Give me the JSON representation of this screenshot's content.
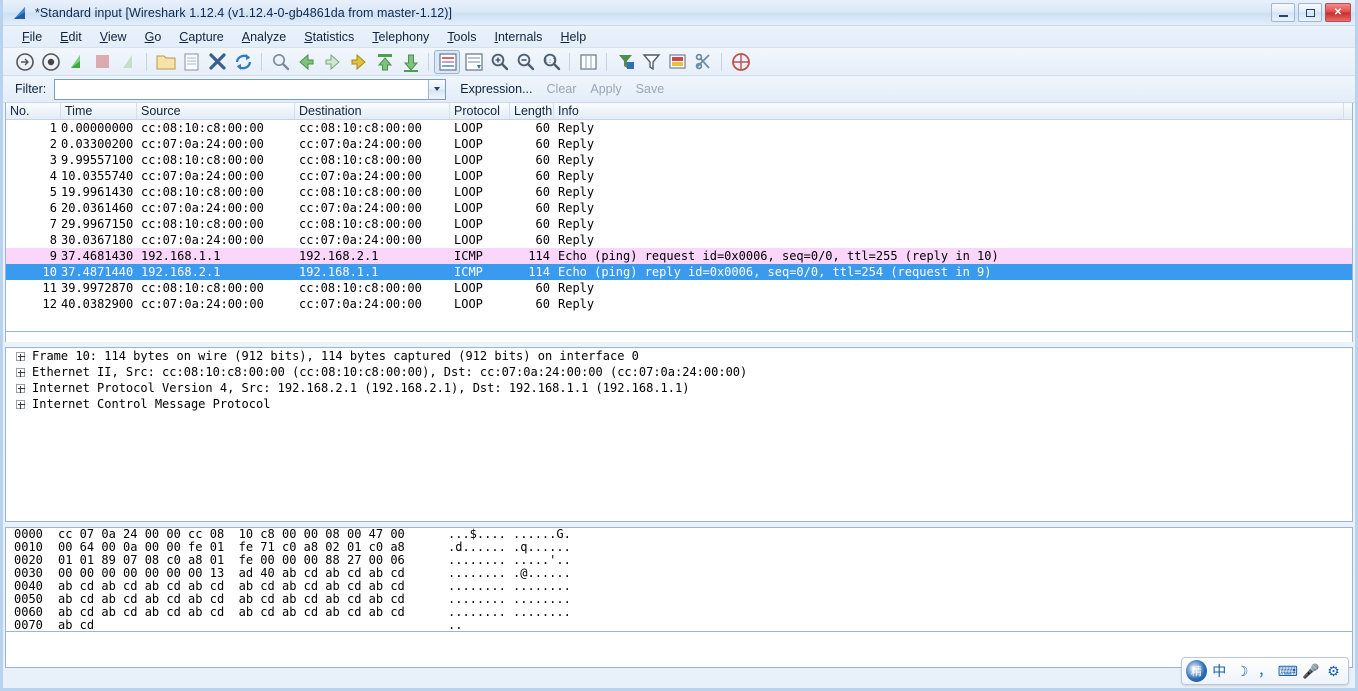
{
  "window": {
    "title": "*Standard input  [Wireshark 1.12.4  (v1.12.4-0-gb4861da from master-1.12)]",
    "icon": "wireshark-fin-icon",
    "minimize_label": "",
    "maximize_label": "",
    "close_label": "✕"
  },
  "menu": {
    "items": [
      {
        "label": "File",
        "accel": "F"
      },
      {
        "label": "Edit",
        "accel": "E"
      },
      {
        "label": "View",
        "accel": "V"
      },
      {
        "label": "Go",
        "accel": "G"
      },
      {
        "label": "Capture",
        "accel": "C"
      },
      {
        "label": "Analyze",
        "accel": "A"
      },
      {
        "label": "Statistics",
        "accel": "S"
      },
      {
        "label": "Telephony",
        "accel": "T"
      },
      {
        "label": "Tools",
        "accel": "T"
      },
      {
        "label": "Internals",
        "accel": "I"
      },
      {
        "label": "Help",
        "accel": "H"
      }
    ]
  },
  "toolbar": {
    "buttons": [
      {
        "name": "interfaces-icon",
        "title": "List the available capture interfaces",
        "enabled": true
      },
      {
        "name": "capture-options-icon",
        "title": "Show the capture options",
        "enabled": true
      },
      {
        "name": "start-capture-icon",
        "title": "Start a new live capture",
        "enabled": true
      },
      {
        "name": "stop-capture-icon",
        "title": "Stop the running live capture",
        "enabled": false
      },
      {
        "name": "restart-capture-icon",
        "title": "Restart the running live capture",
        "enabled": false
      },
      {
        "name": "open-file-icon",
        "title": "Open a capture file",
        "enabled": true
      },
      {
        "name": "save-file-icon",
        "title": "Save this capture file",
        "enabled": true
      },
      {
        "name": "close-file-icon",
        "title": "Close this capture file",
        "enabled": true
      },
      {
        "name": "reload-file-icon",
        "title": "Reload this capture file",
        "enabled": true
      },
      {
        "name": "find-packet-icon",
        "title": "Find a packet",
        "enabled": true
      },
      {
        "name": "go-back-icon",
        "title": "Go back in packet history",
        "enabled": true
      },
      {
        "name": "go-forward-icon",
        "title": "Go forward in packet history",
        "enabled": true
      },
      {
        "name": "go-to-packet-icon",
        "title": "Go to a specific packet",
        "enabled": true
      },
      {
        "name": "go-first-packet-icon",
        "title": "Go to the first packet",
        "enabled": true
      },
      {
        "name": "go-last-packet-icon",
        "title": "Go to the last packet",
        "enabled": true
      },
      {
        "name": "colorize-packet-list-icon",
        "title": "Colorize packet list",
        "enabled": true
      },
      {
        "name": "auto-scroll-icon",
        "title": "Auto scroll in live capture",
        "enabled": true
      },
      {
        "name": "zoom-in-icon",
        "title": "Zoom in",
        "enabled": true
      },
      {
        "name": "zoom-out-icon",
        "title": "Zoom out",
        "enabled": true
      },
      {
        "name": "zoom-reset-icon",
        "title": "Normal size",
        "enabled": true
      },
      {
        "name": "resize-columns-icon",
        "title": "Resize columns",
        "enabled": true
      },
      {
        "name": "capture-filters-icon",
        "title": "Edit capture filters",
        "enabled": true
      },
      {
        "name": "display-filters-icon",
        "title": "Edit display filters",
        "enabled": true
      },
      {
        "name": "coloring-rules-icon",
        "title": "Edit coloring rules",
        "enabled": true
      },
      {
        "name": "preferences-icon",
        "title": "Edit preferences",
        "enabled": true
      },
      {
        "name": "help-contents-icon",
        "title": "Help contents",
        "enabled": true
      }
    ]
  },
  "filter_bar": {
    "label": "Filter:",
    "value": "",
    "placeholder": "",
    "dropdown_icon": "chevron-down-icon",
    "expression_label": "Expression...",
    "clear_label": "Clear",
    "apply_label": "Apply",
    "save_label": "Save"
  },
  "packet_list": {
    "columns": [
      {
        "key": "no",
        "label": "No."
      },
      {
        "key": "time",
        "label": "Time"
      },
      {
        "key": "source",
        "label": "Source"
      },
      {
        "key": "dest",
        "label": "Destination"
      },
      {
        "key": "protocol",
        "label": "Protocol"
      },
      {
        "key": "length",
        "label": "Length"
      },
      {
        "key": "info",
        "label": "Info"
      }
    ],
    "rows": [
      {
        "no": "1",
        "time": "0.00000000",
        "source": "cc:08:10:c8:00:00",
        "dest": "cc:08:10:c8:00:00",
        "protocol": "LOOP",
        "length": "60",
        "info": "Reply",
        "style": ""
      },
      {
        "no": "2",
        "time": "0.03300200",
        "source": "cc:07:0a:24:00:00",
        "dest": "cc:07:0a:24:00:00",
        "protocol": "LOOP",
        "length": "60",
        "info": "Reply",
        "style": ""
      },
      {
        "no": "3",
        "time": "9.99557100",
        "source": "cc:08:10:c8:00:00",
        "dest": "cc:08:10:c8:00:00",
        "protocol": "LOOP",
        "length": "60",
        "info": "Reply",
        "style": ""
      },
      {
        "no": "4",
        "time": "10.0355740",
        "source": "cc:07:0a:24:00:00",
        "dest": "cc:07:0a:24:00:00",
        "protocol": "LOOP",
        "length": "60",
        "info": "Reply",
        "style": ""
      },
      {
        "no": "5",
        "time": "19.9961430",
        "source": "cc:08:10:c8:00:00",
        "dest": "cc:08:10:c8:00:00",
        "protocol": "LOOP",
        "length": "60",
        "info": "Reply",
        "style": ""
      },
      {
        "no": "6",
        "time": "20.0361460",
        "source": "cc:07:0a:24:00:00",
        "dest": "cc:07:0a:24:00:00",
        "protocol": "LOOP",
        "length": "60",
        "info": "Reply",
        "style": ""
      },
      {
        "no": "7",
        "time": "29.9967150",
        "source": "cc:08:10:c8:00:00",
        "dest": "cc:08:10:c8:00:00",
        "protocol": "LOOP",
        "length": "60",
        "info": "Reply",
        "style": ""
      },
      {
        "no": "8",
        "time": "30.0367180",
        "source": "cc:07:0a:24:00:00",
        "dest": "cc:07:0a:24:00:00",
        "protocol": "LOOP",
        "length": "60",
        "info": "Reply",
        "style": ""
      },
      {
        "no": "9",
        "time": "37.4681430",
        "source": "192.168.1.1",
        "dest": "192.168.2.1",
        "protocol": "ICMP",
        "length": "114",
        "info": "Echo (ping) request  id=0x0006, seq=0/0, ttl=255 (reply in 10)",
        "style": "pink"
      },
      {
        "no": "10",
        "time": "37.4871440",
        "source": "192.168.2.1",
        "dest": "192.168.1.1",
        "protocol": "ICMP",
        "length": "114",
        "info": "Echo (ping) reply    id=0x0006, seq=0/0, ttl=254 (request in 9)",
        "style": "sel"
      },
      {
        "no": "11",
        "time": "39.9972870",
        "source": "cc:08:10:c8:00:00",
        "dest": "cc:08:10:c8:00:00",
        "protocol": "LOOP",
        "length": "60",
        "info": "Reply",
        "style": ""
      },
      {
        "no": "12",
        "time": "40.0382900",
        "source": "cc:07:0a:24:00:00",
        "dest": "cc:07:0a:24:00:00",
        "protocol": "LOOP",
        "length": "60",
        "info": "Reply",
        "style": ""
      }
    ],
    "colors": {
      "selected_bg": "#3a9bee",
      "selected_fg": "#ffffff",
      "icmp_bg": "#fbd6fb"
    }
  },
  "packet_details": {
    "expander_icon": "plus-box-icon",
    "rows": [
      {
        "text": "Frame 10: 114 bytes on wire (912 bits), 114 bytes captured (912 bits) on interface 0"
      },
      {
        "text": "Ethernet II, Src: cc:08:10:c8:00:00 (cc:08:10:c8:00:00), Dst: cc:07:0a:24:00:00 (cc:07:0a:24:00:00)"
      },
      {
        "text": "Internet Protocol Version 4, Src: 192.168.2.1 (192.168.2.1), Dst: 192.168.1.1 (192.168.1.1)"
      },
      {
        "text": "Internet Control Message Protocol"
      }
    ]
  },
  "packet_bytes": {
    "rows": [
      {
        "offset": "0000",
        "bytes": "cc 07 0a 24 00 00 cc 08  10 c8 00 00 08 00 47 00",
        "ascii": "...$.... ......G."
      },
      {
        "offset": "0010",
        "bytes": "00 64 00 0a 00 00 fe 01  fe 71 c0 a8 02 01 c0 a8",
        "ascii": ".d...... .q......"
      },
      {
        "offset": "0020",
        "bytes": "01 01 89 07 08 c0 a8 01  fe 00 00 00 88 27 00 06",
        "ascii": "........ .....'.."
      },
      {
        "offset": "0030",
        "bytes": "00 00 00 00 00 00 00 13  ad 40 ab cd ab cd ab cd",
        "ascii": "........ .@......"
      },
      {
        "offset": "0040",
        "bytes": "ab cd ab cd ab cd ab cd  ab cd ab cd ab cd ab cd",
        "ascii": "........ ........"
      },
      {
        "offset": "0050",
        "bytes": "ab cd ab cd ab cd ab cd  ab cd ab cd ab cd ab cd",
        "ascii": "........ ........"
      },
      {
        "offset": "0060",
        "bytes": "ab cd ab cd ab cd ab cd  ab cd ab cd ab cd ab cd",
        "ascii": "........ ........"
      },
      {
        "offset": "0070",
        "bytes": "ab cd",
        "ascii": ".."
      }
    ]
  },
  "ime_toolbar": {
    "buttons": [
      {
        "name": "ime-logo-icon",
        "glyph": "精"
      },
      {
        "name": "ime-chinese-icon",
        "glyph": "中"
      },
      {
        "name": "ime-moon-icon",
        "glyph": "☽"
      },
      {
        "name": "ime-punctuation-icon",
        "glyph": "，"
      },
      {
        "name": "ime-keyboard-icon",
        "glyph": "⌨"
      },
      {
        "name": "ime-voice-icon",
        "glyph": "🎤"
      },
      {
        "name": "ime-settings-icon",
        "glyph": "⚙"
      }
    ]
  }
}
